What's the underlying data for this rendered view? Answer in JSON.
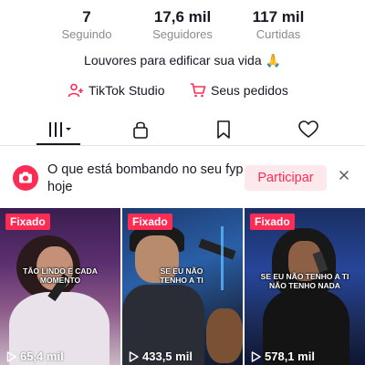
{
  "stats": {
    "following": {
      "value": "7",
      "label": "Seguindo"
    },
    "followers": {
      "value": "17,6 mil",
      "label": "Seguidores"
    },
    "likes": {
      "value": "117 mil",
      "label": "Curtidas"
    }
  },
  "bio": "Louvores para edificar sua vida 🙏",
  "links": {
    "studio": {
      "label": "TikTok Studio",
      "icon": "person-plus-icon"
    },
    "orders": {
      "label": "Seus pedidos",
      "icon": "shopping-cart-icon"
    }
  },
  "tabs": [
    {
      "name": "videos",
      "icon": "grid-icon",
      "active": true
    },
    {
      "name": "private",
      "icon": "lock-icon",
      "active": false
    },
    {
      "name": "saved",
      "icon": "bookmark-icon",
      "active": false
    },
    {
      "name": "liked",
      "icon": "heart-icon",
      "active": false
    }
  ],
  "banner": {
    "text": "O que está bombando no seu fyp hoje",
    "button": "Participar",
    "icon": "camera-icon"
  },
  "videos": [
    {
      "badge": "Fixado",
      "caption": "TÃO LINDO É CADA MOMENTO",
      "views": "65,4 mil"
    },
    {
      "badge": "Fixado",
      "caption": "SE EU NÃO TENHO A TI",
      "views": "433,5 mil"
    },
    {
      "badge": "Fixado",
      "caption": "SE EU NÃO TENHO A TI NÃO TENHO NADA",
      "views": "578,1 mil"
    }
  ],
  "colors": {
    "accent": "#fe2c55",
    "accent_light": "#fde9ec",
    "text": "#161823",
    "muted": "#8a8b91"
  }
}
